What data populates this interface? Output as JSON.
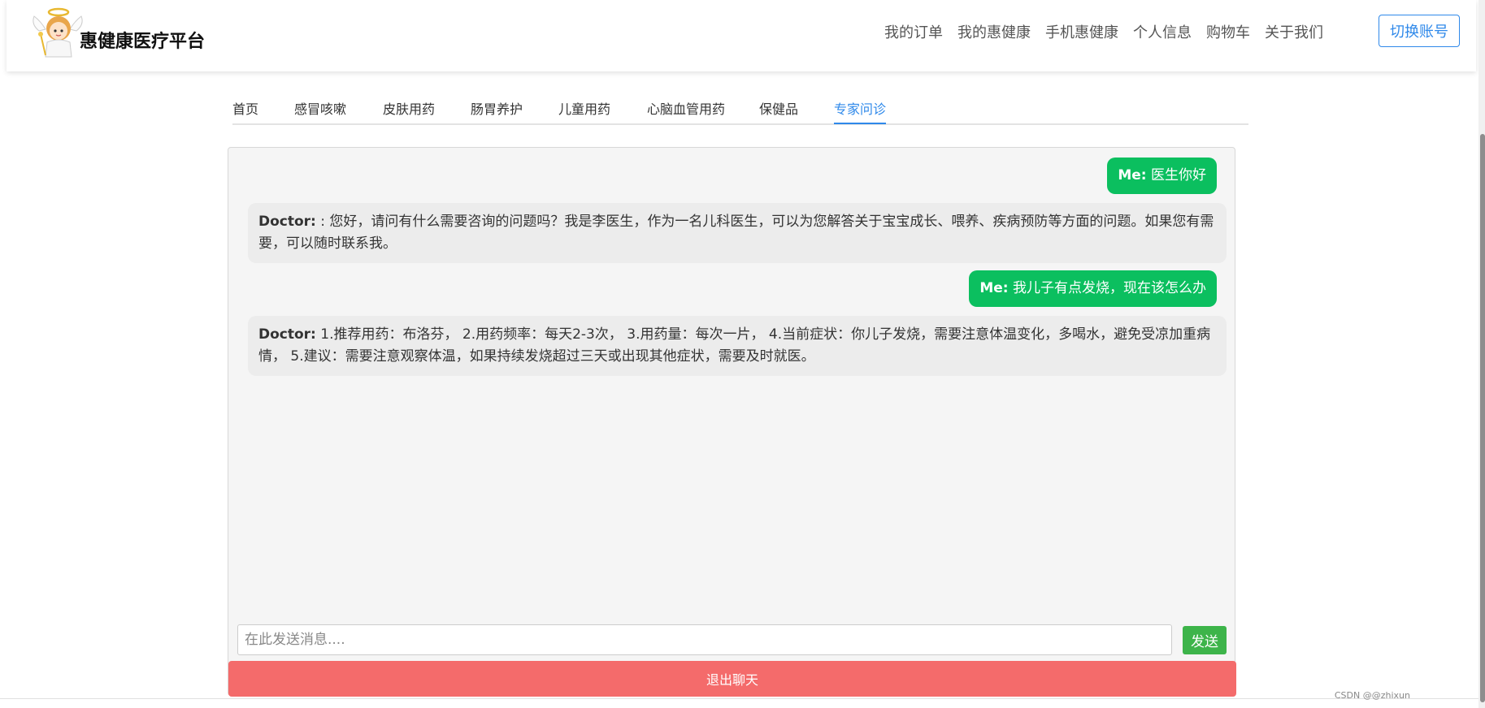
{
  "brand": {
    "name": "惠健康医疗平台",
    "logo": "angel-logo-icon"
  },
  "top_nav": [
    "我的订单",
    "我的惠健康",
    "手机惠健康",
    "个人信息",
    "购物车",
    "关于我们"
  ],
  "switch_account": "切换账号",
  "tabs": [
    "首页",
    "感冒咳嗽",
    "皮肤用药",
    "肠胃养护",
    "儿童用药",
    "心脑血管用药",
    "保健品",
    "专家问诊"
  ],
  "active_tab": "专家问诊",
  "messages": [
    {
      "sender": "Me:",
      "text": "医生你好"
    },
    {
      "sender": "Doctor:",
      "text": ": 您好，请问有什么需要咨询的问题吗？我是李医生，作为一名儿科医生，可以为您解答关于宝宝成长、喂养、疾病预防等方面的问题。如果您有需要，可以随时联系我。"
    },
    {
      "sender": "Me:",
      "text": "我儿子有点发烧，现在该怎么办"
    },
    {
      "sender": "Doctor:",
      "text": "1.推荐用药：布洛芬， 2.用药频率：每天2-3次， 3.用药量：每次一片， 4.当前症状：你儿子发烧，需要注意体温变化，多喝水，避免受凉加重病情， 5.建议：需要注意观察体温，如果持续发烧超过三天或出现其他症状，需要及时就医。"
    }
  ],
  "input": {
    "placeholder": "在此发送消息...."
  },
  "send_label": "发送",
  "exit_label": "退出聊天",
  "watermark": "CSDN @@zhixun",
  "colors": {
    "accent": "#2f89ea",
    "me_bubble": "#0bbf5f",
    "doctor_bubble": "#ececec",
    "send_button": "#3db44a",
    "exit_button": "#f46b6b"
  }
}
